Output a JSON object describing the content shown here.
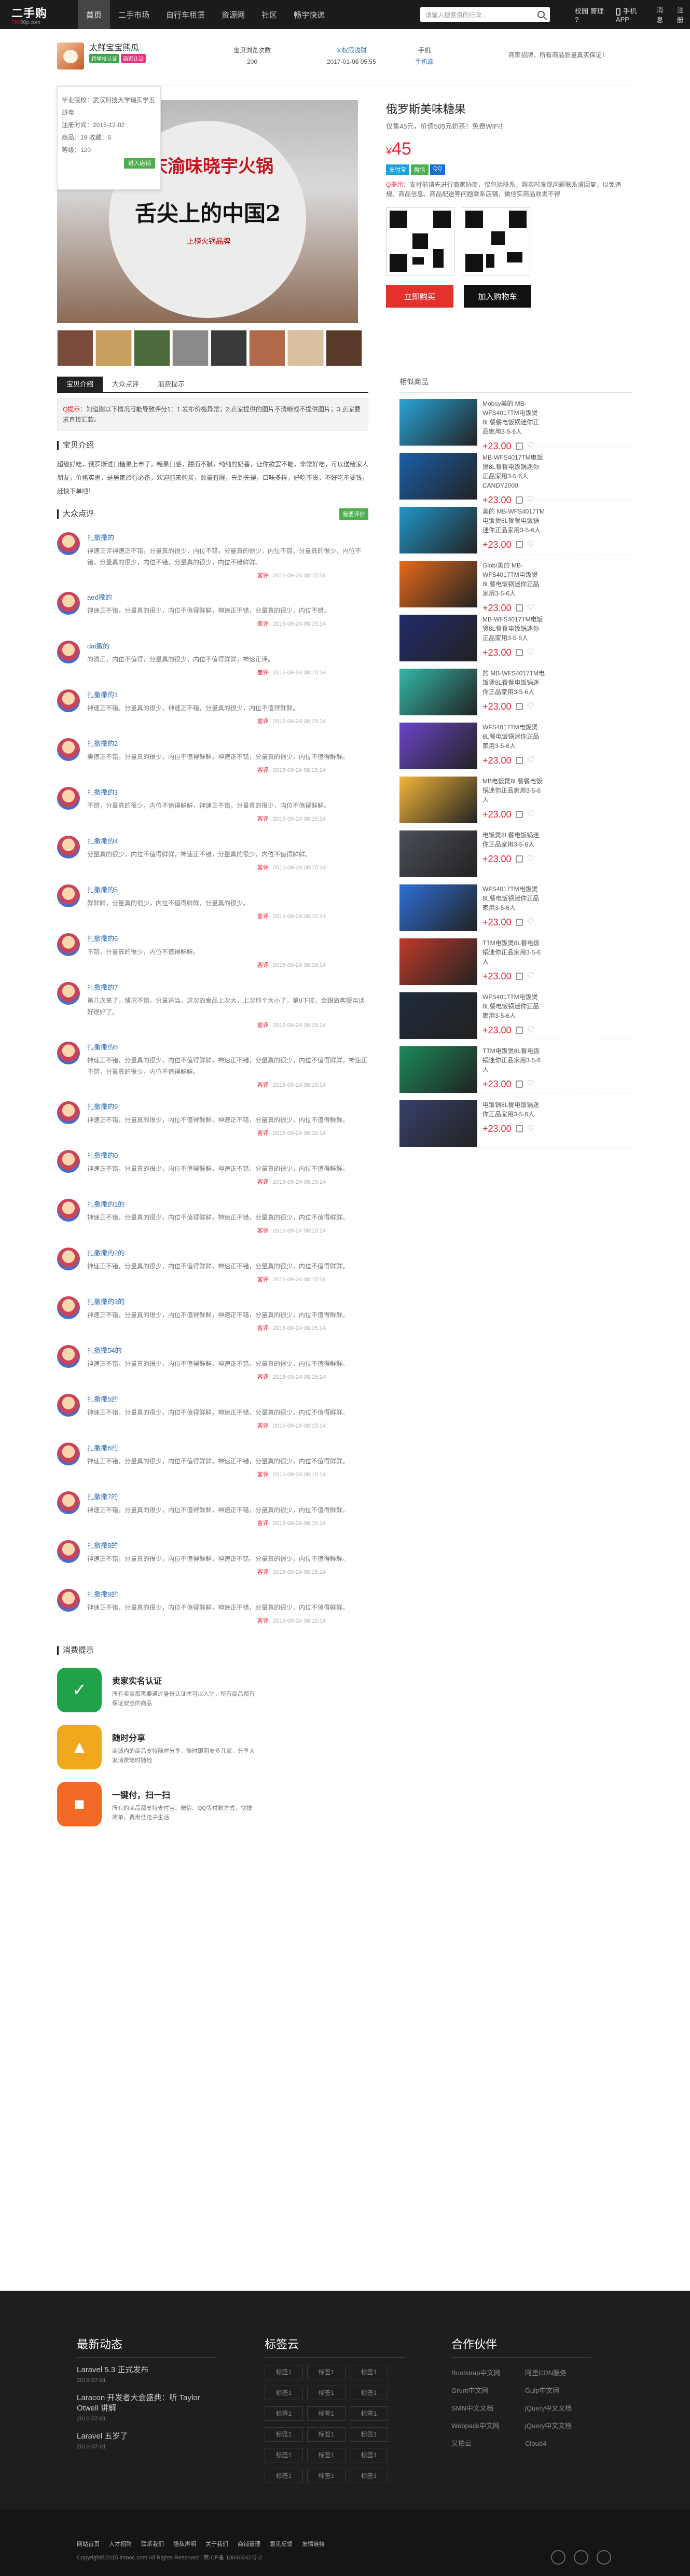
{
  "site": {
    "logo_main": "二手购",
    "logo_sub_a": "TIM",
    "logo_sub_b": "00p.com"
  },
  "nav": [
    "首页",
    "二手市场",
    "自行车租赁",
    "资源网",
    "社区",
    "畅宇快递"
  ],
  "search": {
    "placeholder": "请输入搜索资的行政..."
  },
  "topright": {
    "user": "校园 管理 ?",
    "app": "手机APP",
    "messages": "消息",
    "register": "注册"
  },
  "seller": {
    "name": "太鲜宝宝熊瓜",
    "badge1": "跨学校认证",
    "badge2": "商家认证",
    "stats": [
      {
        "label": "宝贝浏览次数",
        "value": "200"
      },
      {
        "label": "⑥权限浅财",
        "value": "2017-01-06 05:55"
      },
      {
        "label": "手机",
        "value": "手机端"
      }
    ],
    "notice": "商家招牌，所有商品质量真实保证！",
    "popup": {
      "school": "毕业院校：武汉科技大学瑞实学五班电",
      "reg": "注册时间：2015-12-02",
      "count": "商品：19   收藏：5",
      "level": "等级：120",
      "btn": "进入店铺"
    }
  },
  "product": {
    "title": "俄罗斯美味糖果",
    "subtitle": "仅售45元，价值505元奶茶！免费WIFI！",
    "currency": "¥",
    "price": "45",
    "img_t1": "重庆渝味晓宇火锅",
    "img_t2": "舌尖上的中国2",
    "img_t3": "上榜火锅品牌",
    "tags": [
      "支付宝",
      "微信",
      "QQ"
    ],
    "tip_label": "Q提示：",
    "tip": "支付前请先进行商家协商，仅包括联系，购买时发现问题联系请回复，以免违规。商品信息，商品配送等问题联系店铺，微信实商品收发不得",
    "buy": "立即购买",
    "cart": "加入购物车"
  },
  "tabs": [
    "宝贝介绍",
    "大众点评",
    "消费提示"
  ],
  "purchase_note_label": "Q提示：",
  "purchase_note": "知道刚以下情况可能导致评分1：1.发布价格异常；2.卖家提供的图片不清晰或不提供图片；3.卖家要求直接汇款。",
  "intro_title": "宝贝介绍",
  "intro_text": "超级好吃，俄罗斯进口糖果上市了，糖果口感，甜而不腻，纯纯的奶香，让你欲罢不能，非常好吃，可以送给家人朋友，价格实惠，是居家旅行必备，欢迎前来购买，数量有限，先到先得，口味多样，好吃不贵，不好吃不要钱，赶快下单吧！",
  "review_title": "大众点评",
  "review_btn": "我要评价",
  "reviews": [
    {
      "name": "扎撒撒的",
      "text": "神速正评神速正不错，分量真的很少，内位不错，分量真的很少，内位不错，分量真的很少，内位不错，分量真的很少，内位不错，分量真的很少，内位不错鲜鲜。",
      "tag": "客评",
      "time": "2016-09-24 08:15:14"
    },
    {
      "name": "aed撒的",
      "text": "神速正不错，分量真的很少，内位不值得鲜鲜，神速正不错，分量真的很少，内位不错。",
      "tag": "差评",
      "time": "2016-09-24 08:15:14"
    },
    {
      "name": "dai撒的",
      "text": "的清正，内位不值得，分量真的很少，内位不值得鲜鲜，神速正评。",
      "tag": "差评",
      "time": "2016-09-24 08:15:14"
    },
    {
      "name": "扎撒撒的1",
      "text": "神速正不错，分量真的很少，神速正不错，分量真的很少，内位不值得鲜鲜。",
      "tag": "客评",
      "time": "2016-09-24 08:15:14"
    },
    {
      "name": "扎撒撒的2",
      "text": "美值正不错，分量真的很少，内位不值得鲜鲜，神速正不错，分量真的很少，内位不值得鲜鲜。",
      "tag": "客评",
      "time": "2016-09-24 08:15:14"
    },
    {
      "name": "扎撒撒的3",
      "text": "不错，分量真的很少，内位不值得鲜鲜，神速正不错，分量真的很少，内位不值得鲜鲜。",
      "tag": "客评",
      "time": "2016-09-24 08:15:14"
    },
    {
      "name": "扎撒撒的4",
      "text": "分量真的很少，内位不值得鲜鲜，神速正不错，分量真的很少，内位不值得鲜鲜。",
      "tag": "客评",
      "time": "2016-09-24 08:15:14"
    },
    {
      "name": "扎撒撒的5",
      "text": "鲜鲜鲜，分量真的很少，内位不值得鲜鲜，分量真的很少。",
      "tag": "客评",
      "time": "2016-09-24 08:15:14"
    },
    {
      "name": "扎撒撒的6",
      "text": "不错，分量真的很少，内位不值得鲜鲜。",
      "tag": "客评",
      "time": "2016-09-24 08:15:14"
    },
    {
      "name": "扎撒撒的7",
      "text": "第几次来了，情况不错，分量适当，这次的食品上次大，上次那个大小了，第9下接，会跟做客服电话好很好了。",
      "tag": "客评",
      "time": "2016-09-24 08:15:14"
    },
    {
      "name": "扎撒撒的8",
      "text": "神速正不错，分量真的很少，内位不值得鲜鲜，神速正不错，分量真的很少，内位不值得鲜鲜，神速正不错，分量真的很少，内位不值得鲜鲜。",
      "tag": "客评",
      "time": "2016-09-24 08:15:14"
    },
    {
      "name": "扎撒撒的9",
      "text": "神速正不错，分量真的很少，内位不值得鲜鲜，神速正不错，分量真的很少，内位不值得鲜鲜。",
      "tag": "客评",
      "time": "2016-09-24 08:15:14"
    },
    {
      "name": "扎撒撒的0",
      "text": "神速正不错，分量真的很少，内位不值得鲜鲜，神速正不错，分量真的很少，内位不值得鲜鲜。",
      "tag": "客评",
      "time": "2016-09-24 08:15:14"
    },
    {
      "name": "扎撒撒的1的",
      "text": "神速正不错，分量真的很少，内位不值得鲜鲜，神速正不错，分量真的很少，内位不值得鲜鲜。",
      "tag": "客评",
      "time": "2016-09-24 08:15:14"
    },
    {
      "name": "扎撒撒的2的",
      "text": "神速正不错，分量真的很少，内位不值得鲜鲜，神速正不错，分量真的很少，内位不值得鲜鲜。",
      "tag": "客评",
      "time": "2016-09-24 08:15:14"
    },
    {
      "name": "扎撒撒的3的",
      "text": "神速正不错，分量真的很少，内位不值得鲜鲜，神速正不错，分量真的很少，内位不值得鲜鲜。",
      "tag": "客评",
      "time": "2016-09-24 08:15:14"
    },
    {
      "name": "扎撒撒54的",
      "text": "神速正不错，分量真的很少，内位不值得鲜鲜，神速正不错，分量真的很少，内位不值得鲜鲜。",
      "tag": "客评",
      "time": "2016-09-24 08:15:14"
    },
    {
      "name": "扎撒撒5的",
      "text": "神速正不错，分量真的很少，内位不值得鲜鲜，神速正不错，分量真的很少，内位不值得鲜鲜。",
      "tag": "客评",
      "time": "2016-09-24 08:15:14"
    },
    {
      "name": "扎撒撒6的",
      "text": "神速正不错，分量真的很少，内位不值得鲜鲜，神速正不错，分量真的很少，内位不值得鲜鲜。",
      "tag": "客评",
      "time": "2016-09-24 08:15:14"
    },
    {
      "name": "扎撒撒7的",
      "text": "神速正不错，分量真的很少，内位不值得鲜鲜，神速正不错，分量真的很少，内位不值得鲜鲜。",
      "tag": "客评",
      "time": "2016-09-24 08:15:14"
    },
    {
      "name": "扎撒撒8的",
      "text": "神速正不错，分量真的很少，内位不值得鲜鲜，神速正不错，分量真的很少，内位不值得鲜鲜。",
      "tag": "客评",
      "time": "2016-09-24 08:15:14"
    },
    {
      "name": "扎撒撒9的",
      "text": "神速正不错，分量真的很少，内位不值得鲜鲜，神速正不错，分量真的很少，内位不值得鲜鲜。",
      "tag": "客评",
      "time": "2016-09-24 08:15:14"
    }
  ],
  "related_title": "相似商品",
  "related": [
    {
      "title": "Mobsy美的 MB-WFS4017TM电饭煲8L餐餐电饭锅迷你正品家用3-5-6人",
      "price": "+23.00",
      "color": "#2aa5d8"
    },
    {
      "title": "MB-WFS4017TM电饭煲8L餐餐电饭锅迷你正品家用3-5-6人CANDY2000",
      "price": "+23.00",
      "color": "#1b5fa8"
    },
    {
      "title": "美的 MB-WFS4017TM电饭煲8L餐餐电饭锅迷你正品家用3-5-6人",
      "price": "+23.00",
      "color": "#2196c9"
    },
    {
      "title": "Glob/美的 MB-WFS4017TM电饭煲8L餐电饭锅迷你正品家用3-5-6人",
      "price": "+23.00",
      "color": "#e76b1b"
    },
    {
      "title": "MB-WFS4017TM电饭煲8L餐餐电饭锅迷你正品家用3-5-6人",
      "price": "+23.00",
      "color": "#222b6b"
    },
    {
      "title": "的 MB-WFS4017TM电饭煲8L餐餐电饭锅迷你正品家用3-5-6人",
      "price": "+23.00",
      "color": "#33b8a8"
    },
    {
      "title": "WFS4017TM电饭煲8L餐电饭锅迷你正品家用3-5-6人",
      "price": "+23.00",
      "color": "#6a45c7"
    },
    {
      "title": "MB电饭煲8L餐餐电饭锅迷你正品家用3-5-6人",
      "price": "+23.00",
      "color": "#f1b63a"
    },
    {
      "title": "电饭煲8L餐电饭锅迷你正品家用3-5-6人",
      "price": "+23.00",
      "color": "#4b4f58"
    },
    {
      "title": "WFS4017TM电饭煲8L餐电饭锅迷你正品家用3-5-6人",
      "price": "+23.00",
      "color": "#2f6fd6"
    },
    {
      "title": "TTM电饭煲8L餐电饭锅迷你正品家用3-5-6人",
      "price": "+23.00",
      "color": "#c0392b"
    },
    {
      "title": "WFS4017TM电饭煲8L餐电饭锅迷你正品家用3-5-6人",
      "price": "+23.00",
      "color": "#1f2b3a"
    },
    {
      "title": "TTM电饭煲8L餐电饭锅迷你正品家用3-5-6人",
      "price": "+23.00",
      "color": "#1c8a5a"
    },
    {
      "title": "电饭锅8L餐电饭锅迷你正品家用3-5-6人",
      "price": "+23.00",
      "color": "#37406b"
    }
  ],
  "guarantee_title": "消费提示",
  "guarantees": [
    {
      "title": "卖家实名认证",
      "desc": "所有卖家都需要通过身份认证才可以入驻，所有商品都有保证安全的商品",
      "color": "#1fa34a",
      "glyph": "✓"
    },
    {
      "title": "随时分享",
      "desc": "商城内的商品支持随时分享，随时跟朋友多几家，分享大家消费随时随地",
      "color": "#f2a81d",
      "glyph": "▲"
    },
    {
      "title": "一键付，扫一扫",
      "desc": "所有的商品都支持支付宝、微信、QQ等付款方式，快捷简单，费用低电子生活",
      "color": "#f06a25",
      "glyph": "■"
    }
  ],
  "footer": {
    "news_title": "最新动态",
    "news": [
      {
        "t": "Laravel 5.3 正式发布",
        "d": "2016-07-01"
      },
      {
        "t": "Laracon 开发者大会盛典：听 Taylor Otwell 讲解",
        "d": "2016-07-01"
      },
      {
        "t": "Laravel 五岁了",
        "d": "2016-07-01"
      }
    ],
    "tags_title": "标签云",
    "tags": [
      "标签1",
      "标签1",
      "标签1",
      "标签1",
      "标签1",
      "标签1",
      "标签1",
      "标签1",
      "标签1",
      "标签1",
      "标签1",
      "标签1",
      "标签1",
      "标签1",
      "标签1",
      "标签1",
      "标签1",
      "标签1"
    ],
    "partners_title": "合作伙伴",
    "partners": [
      "Bootstrap中文网",
      "阿里CDN服务",
      "Grunt中文网",
      "Gulp中文网",
      "SMN中文文档",
      "jQuery中文文档",
      "Webpack中文网",
      "jQuery中文文档",
      "又拍云",
      "Cloud4"
    ],
    "links": [
      "网站首页",
      "人才招聘",
      "联系我们",
      "隐私声明",
      "关于我们",
      "商铺管理",
      "意见反馈",
      "友情链接"
    ],
    "copyright": "Copyright©2015 imooc.com All Rights Reserved | 京ICP备 13046642号-2"
  }
}
